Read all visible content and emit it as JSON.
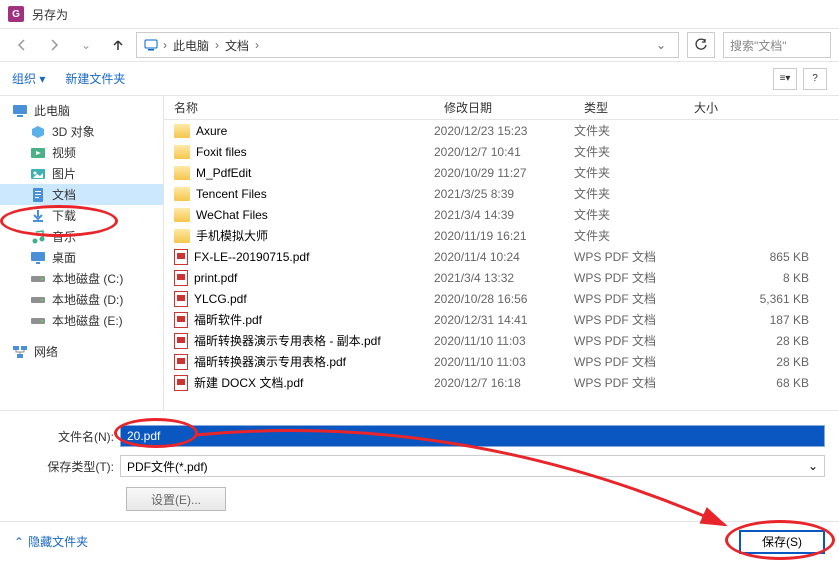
{
  "title": "另存为",
  "breadcrumb": {
    "segs": [
      "此电脑",
      "文档"
    ]
  },
  "nav_dropdown_glyph": "⌄",
  "search": {
    "placeholder": "搜索\"文档\""
  },
  "toolbar": {
    "organize": "组织 ▾",
    "new_folder": "新建文件夹"
  },
  "sidebar": {
    "items": [
      {
        "label": "此电脑",
        "icon": "pc",
        "indent": 0
      },
      {
        "label": "3D 对象",
        "icon": "3d",
        "indent": 1
      },
      {
        "label": "视频",
        "icon": "video",
        "indent": 1
      },
      {
        "label": "图片",
        "icon": "pic",
        "indent": 1
      },
      {
        "label": "文档",
        "icon": "doc",
        "indent": 1,
        "selected": true
      },
      {
        "label": "下载",
        "icon": "dl",
        "indent": 1
      },
      {
        "label": "音乐",
        "icon": "music",
        "indent": 1
      },
      {
        "label": "桌面",
        "icon": "desk",
        "indent": 1
      },
      {
        "label": "本地磁盘 (C:)",
        "icon": "disk",
        "indent": 1
      },
      {
        "label": "本地磁盘 (D:)",
        "icon": "disk",
        "indent": 1
      },
      {
        "label": "本地磁盘 (E:)",
        "icon": "disk",
        "indent": 1
      },
      {
        "label": "网络",
        "icon": "net",
        "indent": 0
      }
    ]
  },
  "columns": {
    "name": "名称",
    "date": "修改日期",
    "type": "类型",
    "size": "大小"
  },
  "files": [
    {
      "name": "Axure",
      "date": "2020/12/23 15:23",
      "type": "文件夹",
      "size": "",
      "kind": "folder"
    },
    {
      "name": "Foxit files",
      "date": "2020/12/7 10:41",
      "type": "文件夹",
      "size": "",
      "kind": "folder"
    },
    {
      "name": "M_PdfEdit",
      "date": "2020/10/29 11:27",
      "type": "文件夹",
      "size": "",
      "kind": "folder"
    },
    {
      "name": "Tencent Files",
      "date": "2021/3/25 8:39",
      "type": "文件夹",
      "size": "",
      "kind": "folder"
    },
    {
      "name": "WeChat Files",
      "date": "2021/3/4 14:39",
      "type": "文件夹",
      "size": "",
      "kind": "folder"
    },
    {
      "name": "手机模拟大师",
      "date": "2020/11/19 16:21",
      "type": "文件夹",
      "size": "",
      "kind": "folder"
    },
    {
      "name": "FX-LE--20190715.pdf",
      "date": "2020/11/4 10:24",
      "type": "WPS PDF 文档",
      "size": "865 KB",
      "kind": "pdf"
    },
    {
      "name": "print.pdf",
      "date": "2021/3/4 13:32",
      "type": "WPS PDF 文档",
      "size": "8 KB",
      "kind": "pdf"
    },
    {
      "name": "YLCG.pdf",
      "date": "2020/10/28 16:56",
      "type": "WPS PDF 文档",
      "size": "5,361 KB",
      "kind": "pdf"
    },
    {
      "name": "福昕软件.pdf",
      "date": "2020/12/31 14:41",
      "type": "WPS PDF 文档",
      "size": "187 KB",
      "kind": "pdf"
    },
    {
      "name": "福昕转换器演示专用表格 - 副本.pdf",
      "date": "2020/11/10 11:03",
      "type": "WPS PDF 文档",
      "size": "28 KB",
      "kind": "pdf"
    },
    {
      "name": "福昕转换器演示专用表格.pdf",
      "date": "2020/11/10 11:03",
      "type": "WPS PDF 文档",
      "size": "28 KB",
      "kind": "pdf"
    },
    {
      "name": "新建 DOCX 文档.pdf",
      "date": "2020/12/7 16:18",
      "type": "WPS PDF 文档",
      "size": "68 KB",
      "kind": "pdf"
    }
  ],
  "filename": {
    "label": "文件名(N):",
    "value": "20.pdf"
  },
  "filetype": {
    "label": "保存类型(T):",
    "value": "PDF文件(*.pdf)"
  },
  "settings_btn": "设置(E)...",
  "hide_folders": "隐藏文件夹",
  "save_btn": "保存(S)"
}
